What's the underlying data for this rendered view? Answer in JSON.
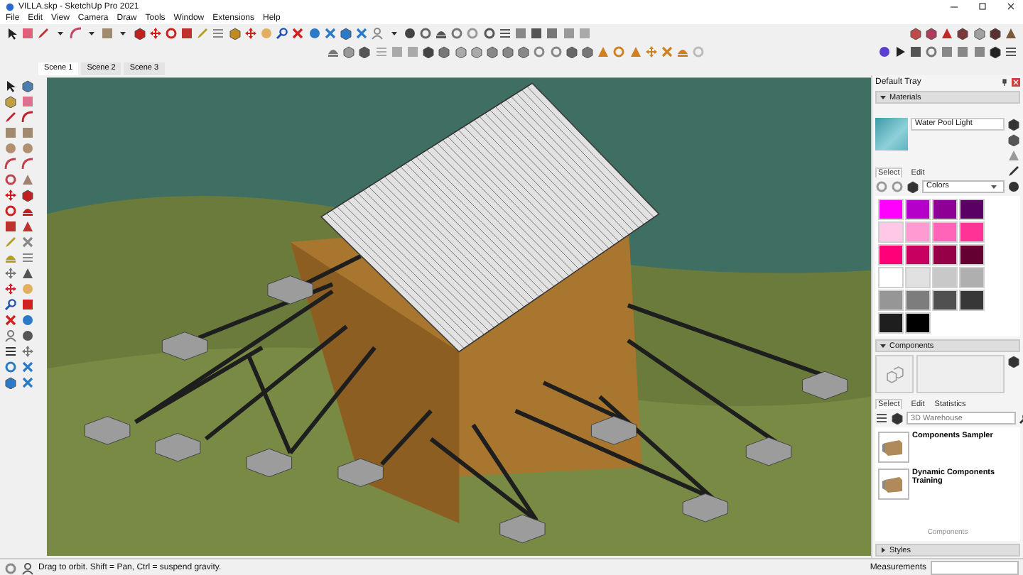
{
  "window": {
    "title": "VILLA.skp - SketchUp Pro 2021"
  },
  "menu": [
    "File",
    "Edit",
    "View",
    "Camera",
    "Draw",
    "Tools",
    "Window",
    "Extensions",
    "Help"
  ],
  "scenes": [
    {
      "label": "Scene 1",
      "selected": true
    },
    {
      "label": "Scene 2",
      "selected": false
    },
    {
      "label": "Scene 3",
      "selected": false
    }
  ],
  "tray": {
    "title": "Default Tray",
    "materials": {
      "title": "Materials",
      "expanded": true,
      "material_name": "Water Pool Light",
      "tabs": [
        {
          "label": "Select",
          "selected": true
        },
        {
          "label": "Edit",
          "selected": false
        }
      ],
      "library": "Colors",
      "swatches": [
        {
          "color": "#ff00ff"
        },
        {
          "color": "#b400c8"
        },
        {
          "color": "#8c0096"
        },
        {
          "color": "#5a0064"
        },
        {
          "color": "#ffc8e6"
        },
        {
          "color": "#ff9bd2"
        },
        {
          "color": "#ff64b9"
        },
        {
          "color": "#ff3296"
        },
        {
          "color": "#ff0078"
        },
        {
          "color": "#c8005f"
        },
        {
          "color": "#960046"
        },
        {
          "color": "#640032"
        },
        {
          "color": "#ffffff"
        },
        {
          "color": "#e1e1e1"
        },
        {
          "color": "#c8c8c8"
        },
        {
          "color": "#afafaf"
        },
        {
          "color": "#969696"
        },
        {
          "color": "#7d7d7d"
        },
        {
          "color": "#505050"
        },
        {
          "color": "#373737"
        },
        {
          "color": "#1e1e1e"
        },
        {
          "color": "#000000"
        }
      ]
    },
    "components": {
      "title": "Components",
      "expanded": true,
      "tabs": [
        {
          "label": "Select",
          "selected": true
        },
        {
          "label": "Edit",
          "selected": false
        },
        {
          "label": "Statistics",
          "selected": false
        }
      ],
      "search_placeholder": "3D Warehouse",
      "items": [
        "Components Sampler",
        "Dynamic Components Training"
      ],
      "footer": "Components"
    },
    "styles": {
      "title": "Styles",
      "expanded": false
    }
  },
  "status_bar": {
    "hint": "Drag to orbit. Shift = Pan, Ctrl = suspend gravity.",
    "measurements_label": "Measurements"
  }
}
